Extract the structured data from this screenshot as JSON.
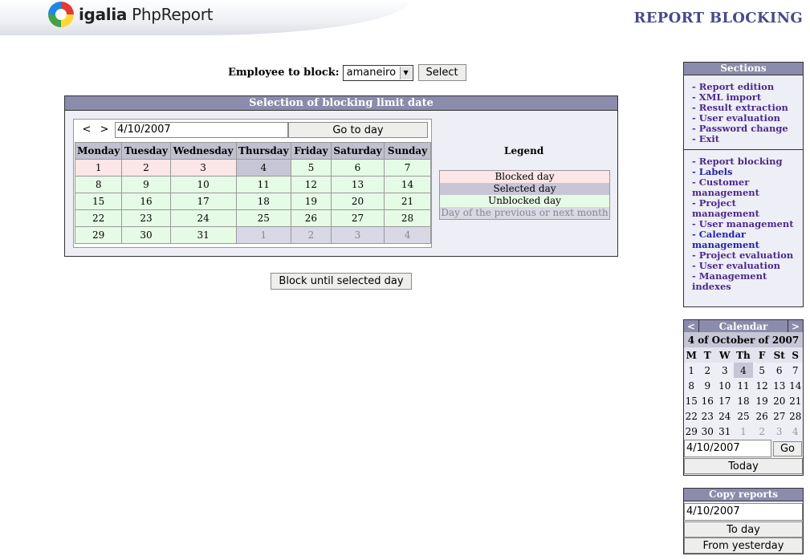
{
  "header": {
    "logo_brand": "igalia",
    "logo_product": "PhpReport",
    "page_title": "REPORT BLOCKING"
  },
  "employee": {
    "label": "Employee to block:",
    "selected": "amaneiro",
    "select_button": "Select"
  },
  "selection": {
    "title": "Selection of blocking limit date",
    "prev_label": "<",
    "next_label": ">",
    "date_value": "4/10/2007",
    "go_label": "Go to day",
    "weekdays": [
      "Monday",
      "Tuesday",
      "Wednesday",
      "Thursday",
      "Friday",
      "Saturday",
      "Sunday"
    ],
    "weeks": [
      [
        {
          "d": "1",
          "s": "blocked"
        },
        {
          "d": "2",
          "s": "blocked"
        },
        {
          "d": "3",
          "s": "blocked"
        },
        {
          "d": "4",
          "s": "selected"
        },
        {
          "d": "5",
          "s": "unblocked"
        },
        {
          "d": "6",
          "s": "unblocked"
        },
        {
          "d": "7",
          "s": "unblocked"
        }
      ],
      [
        {
          "d": "8",
          "s": "unblocked"
        },
        {
          "d": "9",
          "s": "unblocked"
        },
        {
          "d": "10",
          "s": "unblocked"
        },
        {
          "d": "11",
          "s": "unblocked"
        },
        {
          "d": "12",
          "s": "unblocked"
        },
        {
          "d": "13",
          "s": "unblocked"
        },
        {
          "d": "14",
          "s": "unblocked"
        }
      ],
      [
        {
          "d": "15",
          "s": "unblocked"
        },
        {
          "d": "16",
          "s": "unblocked"
        },
        {
          "d": "17",
          "s": "unblocked"
        },
        {
          "d": "18",
          "s": "unblocked"
        },
        {
          "d": "19",
          "s": "unblocked"
        },
        {
          "d": "20",
          "s": "unblocked"
        },
        {
          "d": "21",
          "s": "unblocked"
        }
      ],
      [
        {
          "d": "22",
          "s": "unblocked"
        },
        {
          "d": "23",
          "s": "unblocked"
        },
        {
          "d": "24",
          "s": "unblocked"
        },
        {
          "d": "25",
          "s": "unblocked"
        },
        {
          "d": "26",
          "s": "unblocked"
        },
        {
          "d": "27",
          "s": "unblocked"
        },
        {
          "d": "28",
          "s": "unblocked"
        }
      ],
      [
        {
          "d": "29",
          "s": "unblocked"
        },
        {
          "d": "30",
          "s": "unblocked"
        },
        {
          "d": "31",
          "s": "unblocked"
        },
        {
          "d": "1",
          "s": "other"
        },
        {
          "d": "2",
          "s": "other"
        },
        {
          "d": "3",
          "s": "other"
        },
        {
          "d": "4",
          "s": "other"
        }
      ]
    ],
    "legend_title": "Legend",
    "legend": [
      {
        "label": "Blocked day",
        "s": "blocked"
      },
      {
        "label": "Selected day",
        "s": "selected"
      },
      {
        "label": "Unblocked day",
        "s": "unblocked"
      },
      {
        "label": "Day of the previous or next month",
        "s": "other"
      }
    ],
    "block_button": "Block until selected day"
  },
  "sections": {
    "title": "Sections",
    "group1": [
      {
        "label": "- Report edition",
        "color": "#4b2a8a"
      },
      {
        "label": "- XML import",
        "color": "#4b2a8a"
      },
      {
        "label": "- Result extraction",
        "color": "#4b2a8a"
      },
      {
        "label": "- User evaluation",
        "color": "#4b2a8a"
      },
      {
        "label": "- Password change",
        "color": "#4b2a8a"
      },
      {
        "label": "- Exit",
        "color": "#4b2a8a"
      }
    ],
    "group2": [
      {
        "label": "- Report blocking",
        "color": "#4b2a8a"
      },
      {
        "label": "- Labels",
        "color": "#2222aa"
      },
      {
        "label": "- Customer management",
        "color": "#4b2a8a"
      },
      {
        "label": "- Project management",
        "color": "#4b2a8a"
      },
      {
        "label": "- User management",
        "color": "#4b2a8a"
      },
      {
        "label": "- Calendar management",
        "color": "#2222aa"
      },
      {
        "label": "- Project evaluation",
        "color": "#4b2a8a"
      },
      {
        "label": "- User evaluation",
        "color": "#4b2a8a"
      },
      {
        "label": "- Management indexes",
        "color": "#4b2a8a"
      }
    ]
  },
  "mini_calendar": {
    "title": "Calendar",
    "prev_label": "<",
    "next_label": ">",
    "month_label": "4 of October of 2007",
    "weekdays": [
      "M",
      "T",
      "W",
      "Th",
      "F",
      "St",
      "S"
    ],
    "weeks": [
      [
        {
          "d": "1"
        },
        {
          "d": "2"
        },
        {
          "d": "3"
        },
        {
          "d": "4",
          "sel": true
        },
        {
          "d": "5"
        },
        {
          "d": "6"
        },
        {
          "d": "7"
        }
      ],
      [
        {
          "d": "8"
        },
        {
          "d": "9"
        },
        {
          "d": "10"
        },
        {
          "d": "11"
        },
        {
          "d": "12"
        },
        {
          "d": "13"
        },
        {
          "d": "14"
        }
      ],
      [
        {
          "d": "15"
        },
        {
          "d": "16"
        },
        {
          "d": "17"
        },
        {
          "d": "18"
        },
        {
          "d": "19"
        },
        {
          "d": "20"
        },
        {
          "d": "21"
        }
      ],
      [
        {
          "d": "22"
        },
        {
          "d": "23"
        },
        {
          "d": "24"
        },
        {
          "d": "25"
        },
        {
          "d": "26"
        },
        {
          "d": "27"
        },
        {
          "d": "28"
        }
      ],
      [
        {
          "d": "29"
        },
        {
          "d": "30"
        },
        {
          "d": "31"
        },
        {
          "d": "1",
          "oth": true
        },
        {
          "d": "2",
          "oth": true
        },
        {
          "d": "3",
          "oth": true
        },
        {
          "d": "4",
          "oth": true
        }
      ]
    ],
    "date_value": "4/10/2007",
    "go_label": "Go",
    "today_label": "Today"
  },
  "copy_reports": {
    "title": "Copy reports",
    "date_value": "4/10/2007",
    "to_day_label": "To day",
    "from_yesterday_label": "From yesterday"
  }
}
